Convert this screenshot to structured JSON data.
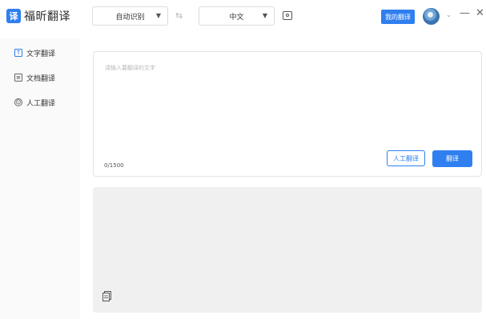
{
  "app": {
    "logo_badge": "译",
    "name": "福昕翻译"
  },
  "toolbar": {
    "source_lang": "自动识别",
    "target_lang": "中文",
    "swap_icon": "swap-arrows-icon",
    "camera_icon": "camera-icon",
    "my_translate_label": "我的翻译"
  },
  "window_controls": {
    "minimize": "—",
    "close": "✕",
    "dropdown": "⌄"
  },
  "sidebar": {
    "items": [
      {
        "label": "文字翻译",
        "icon": "text-icon",
        "active": true
      },
      {
        "label": "文档翻译",
        "icon": "document-icon",
        "active": false
      },
      {
        "label": "人工翻译",
        "icon": "human-icon",
        "active": false
      }
    ]
  },
  "input": {
    "placeholder": "请输入要翻译的文字",
    "counter": "0/1500",
    "human_button": "人工翻译",
    "translate_button": "翻译"
  },
  "output": {
    "copy_icon": "copy-icon"
  },
  "colors": {
    "accent": "#2f7ff0",
    "output_bg": "#f0f0f0"
  }
}
